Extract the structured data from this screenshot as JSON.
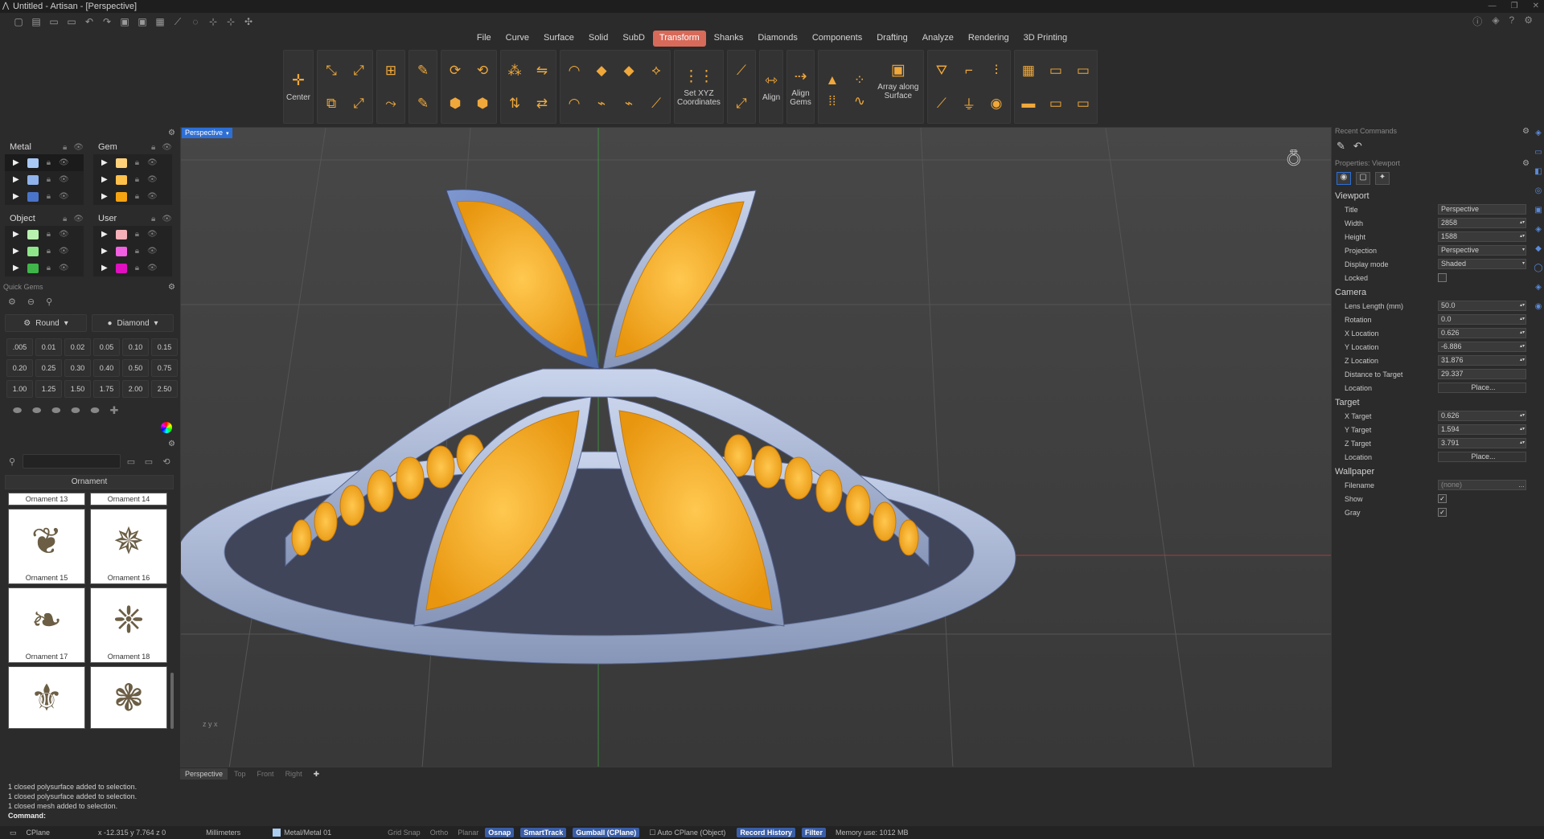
{
  "window": {
    "title": "Untitled - Artisan - [Perspective]"
  },
  "menu": [
    "File",
    "Curve",
    "Surface",
    "Solid",
    "SubD",
    "Transform",
    "Shanks",
    "Diamonds",
    "Components",
    "Drafting",
    "Analyze",
    "Rendering",
    "3D Printing"
  ],
  "menu_active": "Transform",
  "ribbon": {
    "center": "Center",
    "set_xyz_line1": "Set XYZ",
    "set_xyz_line2": "Coordinates",
    "align": "Align",
    "align_gems_line1": "Align",
    "align_gems_line2": "Gems",
    "array_line1": "Array along",
    "array_line2": "Surface"
  },
  "layers": {
    "metal": {
      "title": "Metal",
      "colors": [
        "#a8c8f5",
        "#8fb3ea",
        "#4a74c9"
      ]
    },
    "gem": {
      "title": "Gem",
      "colors": [
        "#ffd27a",
        "#ffc04a",
        "#f5a310"
      ]
    },
    "object": {
      "title": "Object",
      "colors": [
        "#b8f0b0",
        "#8ee58a",
        "#3fb54a"
      ]
    },
    "user": {
      "title": "User",
      "colors": [
        "#f5b0b8",
        "#f060e0",
        "#e010c0"
      ]
    }
  },
  "quick_gems": {
    "title": "Quick Gems",
    "cut": "Round",
    "material": "Diamond",
    "sizes": [
      ".005",
      "0.01",
      "0.02",
      "0.05",
      "0.10",
      "0.15",
      "0.20",
      "0.25",
      "0.30",
      "0.40",
      "0.50",
      "0.75",
      "1.00",
      "1.25",
      "1.50",
      "1.75",
      "2.00",
      "2.50"
    ]
  },
  "library": {
    "category": "Ornament",
    "items": [
      "Ornament 13",
      "Ornament 14",
      "Ornament 15",
      "Ornament 16",
      "Ornament 17",
      "Ornament 18"
    ]
  },
  "viewport": {
    "tab": "Perspective",
    "bottom_tabs": [
      "Perspective",
      "Top",
      "Front",
      "Right"
    ],
    "axis_label": "z  y  x"
  },
  "right_panel": {
    "recent_title": "Recent Commands",
    "props_title": "Properties: Viewport",
    "viewport_group": "Viewport",
    "vp": [
      [
        "Title",
        "Perspective"
      ],
      [
        "Width",
        "2858"
      ],
      [
        "Height",
        "1588"
      ],
      [
        "Projection",
        "Perspective"
      ],
      [
        "Display mode",
        "Shaded"
      ]
    ],
    "locked_label": "Locked",
    "camera_group": "Camera",
    "cam": [
      [
        "Lens Length (mm)",
        "50.0"
      ],
      [
        "Rotation",
        "0.0"
      ],
      [
        "X Location",
        "0.626"
      ],
      [
        "Y Location",
        "-6.886"
      ],
      [
        "Z Location",
        "31.876"
      ],
      [
        "Distance to Target",
        "29.337"
      ]
    ],
    "location_label": "Location",
    "place_btn": "Place...",
    "target_group": "Target",
    "tgt": [
      [
        "X Target",
        "0.626"
      ],
      [
        "Y Target",
        "1.594"
      ],
      [
        "Z Target",
        "3.791"
      ]
    ],
    "wallpaper_group": "Wallpaper",
    "filename_label": "Filename",
    "filename_value": "(none)",
    "show_label": "Show",
    "gray_label": "Gray"
  },
  "command_history": [
    "1 closed polysurface added to selection.",
    "1 closed polysurface added to selection.",
    "1 closed mesh added to selection."
  ],
  "command_prompt": "Command:",
  "status": {
    "cplane": "CPlane",
    "coords": "x -12.315  y 7.764  z 0",
    "units": "Millimeters",
    "layer": "Metal/Metal 01",
    "grid_snap": "Grid Snap",
    "ortho": "Ortho",
    "planar": "Planar",
    "osnap": "Osnap",
    "smarttrack": "SmartTrack",
    "gumball": "Gumball (CPlane)",
    "auto_cplane": "Auto CPlane (Object)",
    "record_history": "Record History",
    "filter": "Filter",
    "memory": "Memory use: 1012 MB"
  }
}
